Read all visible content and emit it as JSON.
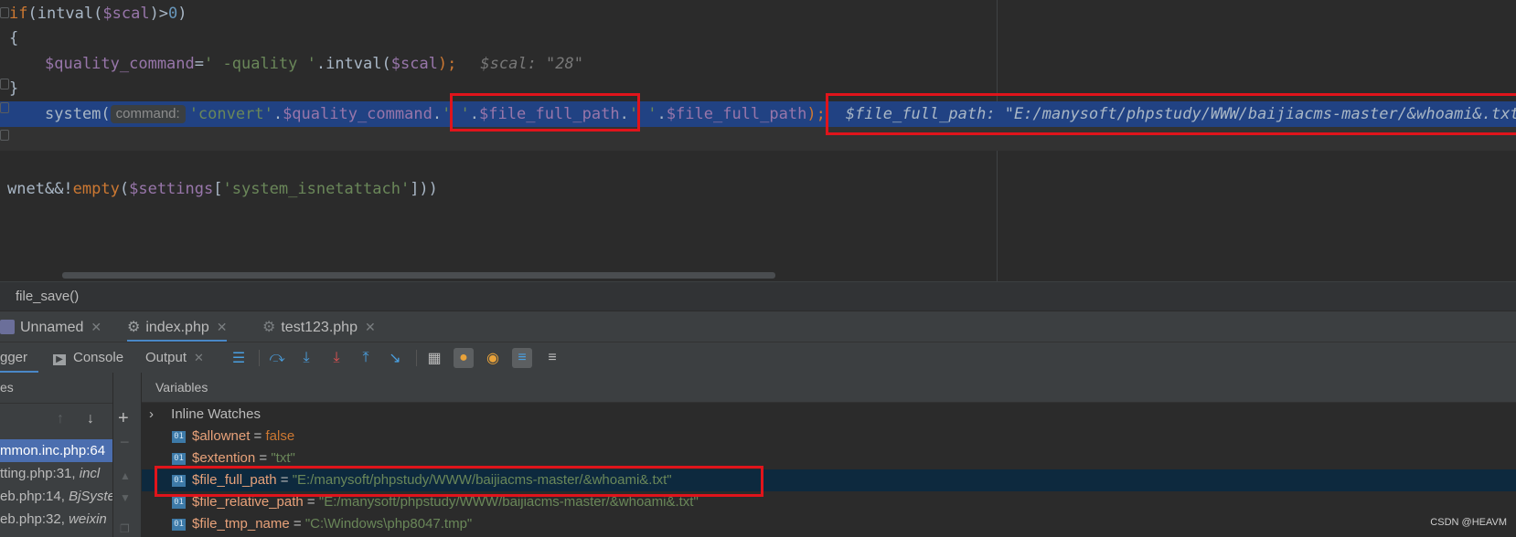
{
  "editor": {
    "lines": [
      {
        "kw_if": "if",
        "text1": "(intval(",
        "var": "$scal",
        "text2": ")>",
        "num": "0",
        "text3": ")"
      },
      {
        "text": "{"
      },
      {
        "var": "$quality_command",
        "eq": "=",
        "str": "' -quality '",
        "mid": ".intval(",
        "var2": "$scal",
        "end": ");",
        "hint": "$scal: \"28\""
      },
      {
        "text": "}"
      },
      {
        "func": "system(",
        "param_hint": "command:",
        "str1": "'convert'",
        "dot1": ".",
        "var1": "$quality_command",
        "dot2": ".",
        "str2": "' '",
        "dot3": ".",
        "var2": "$file_full_path",
        "dot4": ".",
        "str3": "' '",
        "dot5": ".",
        "var3": "$file_full_path",
        "end": ");",
        "dbg_hint": "$file_full_path: \"E:/manysoft/phpstudy/WWW/baijiacms-master/&whoami&.txt\""
      },
      {
        "prefix": "wnet",
        "op": "&&!",
        "fn": "empty",
        "open": "(",
        "var": "$settings",
        "br1": "[",
        "str": "'system_isnetattach'",
        "br2": "]))"
      }
    ]
  },
  "breadcrumb": {
    "text": "file_save()"
  },
  "session_tabs": [
    {
      "label": "Unnamed"
    },
    {
      "label": "index.php"
    },
    {
      "label": "test123.php"
    }
  ],
  "tool_tabs": [
    {
      "label": "gger"
    },
    {
      "label": "Console"
    },
    {
      "label": "Output"
    }
  ],
  "frames": {
    "header": "es",
    "rows": [
      {
        "file": "mmon.inc.php:64",
        "fn": ""
      },
      {
        "file": "tting.php:31, ",
        "fn": "incl"
      },
      {
        "file": "eb.php:14, ",
        "fn": "BjSyste"
      },
      {
        "file": "eb.php:32, ",
        "fn": "weixin"
      }
    ]
  },
  "variables": {
    "header": "Variables",
    "inline_watches": "Inline Watches",
    "items": [
      {
        "name": "$allownet",
        "value": "false",
        "type": "bool"
      },
      {
        "name": "$extention",
        "value": "\"txt\"",
        "type": "string"
      },
      {
        "name": "$file_full_path",
        "value": "\"E:/manysoft/phpstudy/WWW/baijiacms-master/&whoami&.txt\"",
        "type": "string"
      },
      {
        "name": "$file_relative_path",
        "value": "\"E:/manysoft/phpstudy/WWW/baijiacms-master/&whoami&.txt\"",
        "type": "string"
      },
      {
        "name": "$file_tmp_name",
        "value": "\"C:\\Windows\\php8047.tmp\"",
        "type": "string"
      }
    ],
    "badge": "01"
  },
  "watermark": "CSDN @HEAVM",
  "colors": {
    "selection": "#214283",
    "highlight_box": "#e0141b",
    "accent": "#4a88c7"
  }
}
